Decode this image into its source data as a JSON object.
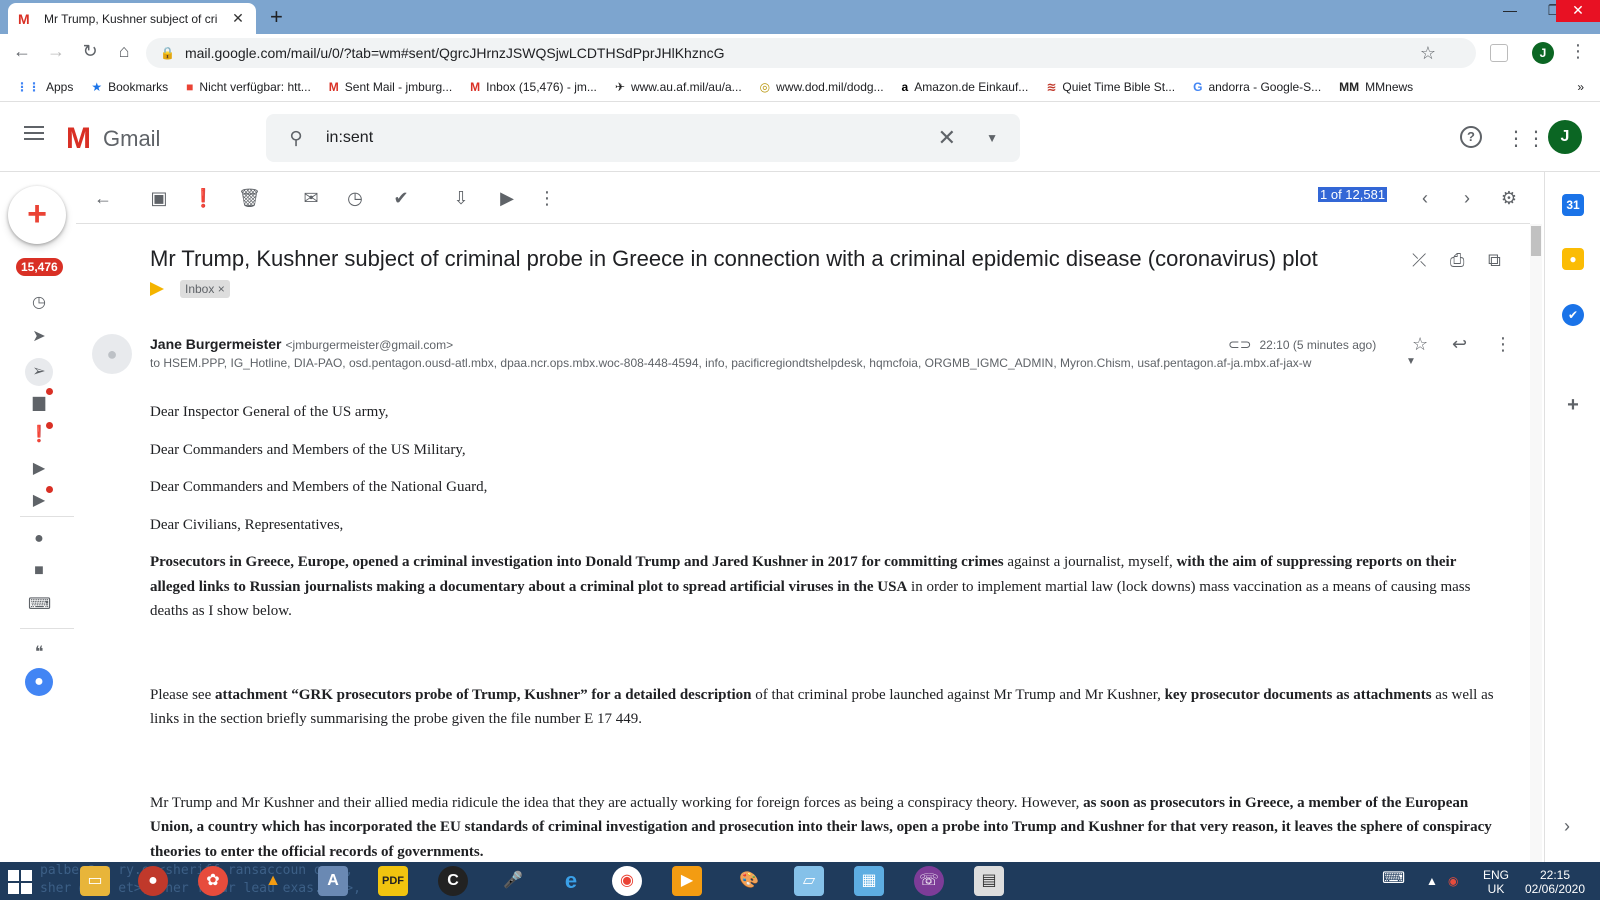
{
  "browser": {
    "tab_title": "Mr Trump, Kushner subject of cri",
    "tab_favicon": "M",
    "url": "mail.google.com/mail/u/0/?tab=wm#sent/QgrcJHrnzJSWQSjwLCDTHSdPprJHlKhzncG",
    "profile_initial": "J",
    "bookmarks": [
      {
        "label": "Apps",
        "icon": "apps-grid-icon"
      },
      {
        "label": "Bookmarks",
        "icon": "star-icon"
      },
      {
        "label": "Nicht verfügbar: htt...",
        "icon": "colored-squares-icon"
      },
      {
        "label": "Sent Mail - jmburg...",
        "icon": "gmail-icon"
      },
      {
        "label": "Inbox (15,476) - jm...",
        "icon": "gmail-icon"
      },
      {
        "label": "www.au.af.mil/au/a...",
        "icon": "airforce-wings-icon"
      },
      {
        "label": "www.dod.mil/dodg...",
        "icon": "seal-icon"
      },
      {
        "label": "Amazon.de Einkauf...",
        "icon": "amazon-icon"
      },
      {
        "label": "Quiet Time Bible St...",
        "icon": "flag-icon"
      },
      {
        "label": "andorra - Google-S...",
        "icon": "google-icon"
      },
      {
        "label": "MMnews",
        "icon": "mmnews-icon"
      }
    ]
  },
  "gmail": {
    "logo_text": "Gmail",
    "search_value": "in:sent",
    "avatar_initial": "J",
    "unread_badge": "15,476",
    "pager_text": "1 of 12,581"
  },
  "message": {
    "subject": "Mr Trump, Kushner subject of criminal probe in Greece in connection with a criminal epidemic disease (coronavirus) plot",
    "label_chip": "Inbox",
    "label_chip_close": "×",
    "sender_name": "Jane Burgermeister",
    "sender_email": "<jmburgermeister@gmail.com>",
    "time": "22:10 (5 minutes ago)",
    "recipients": "to HSEM.PPP, IG_Hotline, DIA-PAO, osd.pentagon.ousd-atl.mbx, dpaa.ncr.ops.mbx.woc-808-448-4594, info, pacificregiondtshelpdesk, hqmcfoia, ORGMB_IGMC_ADMIN, Myron.Chism, usaf.pentagon.af-ja.mbx.af-jax-w",
    "greetings": [
      "Dear Inspector General of the US army,",
      "Dear Commanders and Members of the US Military,",
      "Dear Commanders and Members of the National Guard,",
      "Dear Civilians, Representatives,"
    ],
    "p1": [
      {
        "t": "Prosecutors in Greece, Europe, opened a criminal investigation into Donald Trump and Jared Kushner in 2017 for committing crimes",
        "b": true
      },
      {
        "t": " against a journalist, myself, ",
        "b": false
      },
      {
        "t": "with the aim of suppressing reports on their alleged links to Russian journalists making a documentary about a criminal plot to spread artificial viruses in the USA",
        "b": true
      },
      {
        "t": " in order to implement martial law (lock downs) mass vaccination as a means of causing mass deaths as I show below.",
        "b": false
      }
    ],
    "p2": [
      {
        "t": "Please see ",
        "b": false
      },
      {
        "t": "attachment “GRK prosecutors probe of Trump, Kushner” for a detailed description",
        "b": true
      },
      {
        "t": " of that criminal probe launched against Mr Trump and Mr Kushner, ",
        "b": false
      },
      {
        "t": "key prosecutor documents as attachments",
        "b": true
      },
      {
        "t": " as well as links in the section briefly summarising the probe given the file number E 17 449.",
        "b": false
      }
    ],
    "p3": [
      {
        "t": "Mr Trump and Mr Kushner and their allied media ridicule the idea that they are actually working for foreign forces as being a conspiracy theory. However, ",
        "b": false
      },
      {
        "t": "as soon as prosecutors in Greece, a member of the European Union, a country which has incorporated the EU standards of criminal investigation and prosecution into their laws, open a probe into Trump and Kushner for that very reason, it leaves the sphere of conspiracy theories to enter the official records of governments.",
        "b": true
      }
    ]
  },
  "taskbar": {
    "overlay_line1": "palbe @sr ry.o   <sheriff ransaccoun  org>,",
    "overlay_line2": "sher @wcc et>, sher ffpar leau exas.  rg>,",
    "lang_top": "ENG",
    "lang_bottom": "UK",
    "time": "22:15",
    "date": "02/06/2020"
  },
  "colors": {
    "tabstrip": "#7da5cf",
    "gmail_red": "#d93025",
    "selection": "#3367d6",
    "taskbar": "#1f3b5c"
  }
}
